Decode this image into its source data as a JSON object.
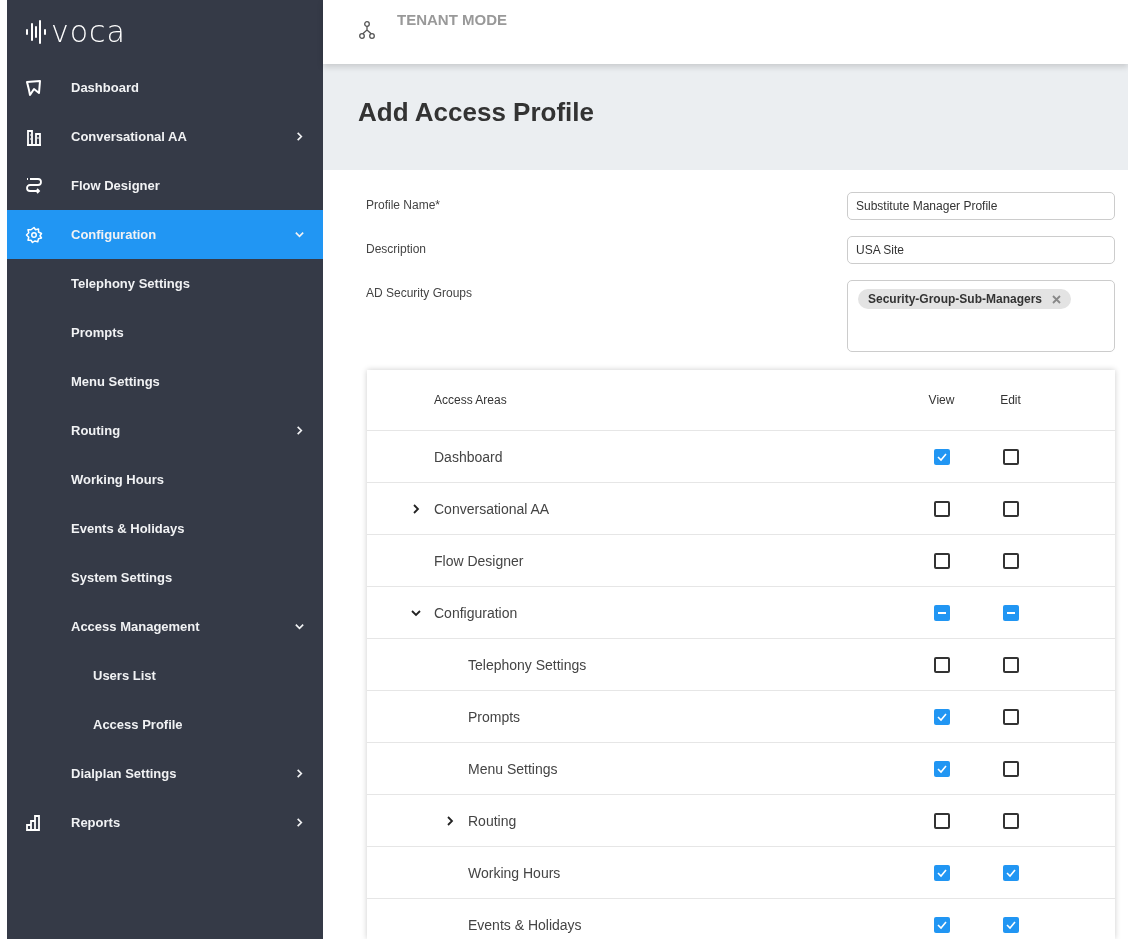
{
  "sidebar": {
    "logo": "voca",
    "items": [
      {
        "label": "Dashboard",
        "selected": false
      },
      {
        "label": "Conversational AA",
        "selected": false,
        "expanded": false
      },
      {
        "label": "Flow Designer",
        "selected": false
      },
      {
        "label": "Configuration",
        "selected": true,
        "expanded": true,
        "children": [
          {
            "label": "Telephony Settings",
            "selected": false
          },
          {
            "label": "Prompts",
            "selected": false
          },
          {
            "label": "Menu Settings",
            "selected": false
          },
          {
            "label": "Routing",
            "selected": false,
            "expanded": false
          },
          {
            "label": "Working Hours",
            "selected": false
          },
          {
            "label": "Events & Holidays",
            "selected": false
          },
          {
            "label": "System Settings",
            "selected": false
          },
          {
            "label": "Access Management",
            "selected": false,
            "expanded": true,
            "children": [
              {
                "label": "Users List",
                "selected": false
              },
              {
                "label": "Access Profile",
                "selected": false
              }
            ]
          },
          {
            "label": "Dialplan Settings",
            "selected": false,
            "expanded": false
          }
        ]
      },
      {
        "label": "Reports",
        "selected": false,
        "expanded": false
      }
    ]
  },
  "topbar": {
    "mode": "TENANT MODE"
  },
  "page": {
    "title": "Add Access Profile"
  },
  "form": {
    "fields": [
      {
        "label": "Profile Name*",
        "value": "Substitute Manager Profile"
      },
      {
        "label": "Description",
        "value": "USA Site"
      }
    ],
    "groups": {
      "label": "AD Security Groups",
      "chips": [
        "Security-Group-Sub-Managers"
      ]
    }
  },
  "table": {
    "columns": [
      "Access Areas",
      "View",
      "Edit"
    ],
    "rows": [
      {
        "label": "Dashboard",
        "view": {
          "checked": true
        },
        "edit": {
          "checked": false
        }
      },
      {
        "label": "Conversational AA",
        "expanded": false,
        "view": {
          "checked": false
        },
        "edit": {
          "checked": false
        }
      },
      {
        "label": "Flow Designer",
        "view": {
          "checked": false
        },
        "edit": {
          "checked": false
        }
      },
      {
        "label": "Configuration",
        "expanded": true,
        "view": {
          "partial": true
        },
        "edit": {
          "partial": true
        },
        "children": [
          {
            "label": "Telephony Settings",
            "view": {
              "checked": false
            },
            "edit": {
              "checked": false
            }
          },
          {
            "label": "Prompts",
            "view": {
              "checked": true
            },
            "edit": {
              "checked": false
            }
          },
          {
            "label": "Menu Settings",
            "view": {
              "checked": true
            },
            "edit": {
              "checked": false
            }
          },
          {
            "label": "Routing",
            "expanded": false,
            "view": {
              "checked": false
            },
            "edit": {
              "checked": false
            }
          },
          {
            "label": "Working Hours",
            "view": {
              "checked": true
            },
            "edit": {
              "checked": true
            }
          },
          {
            "label": "Events & Holidays",
            "view": {
              "checked": true
            },
            "edit": {
              "checked": true
            }
          }
        ]
      }
    ]
  }
}
